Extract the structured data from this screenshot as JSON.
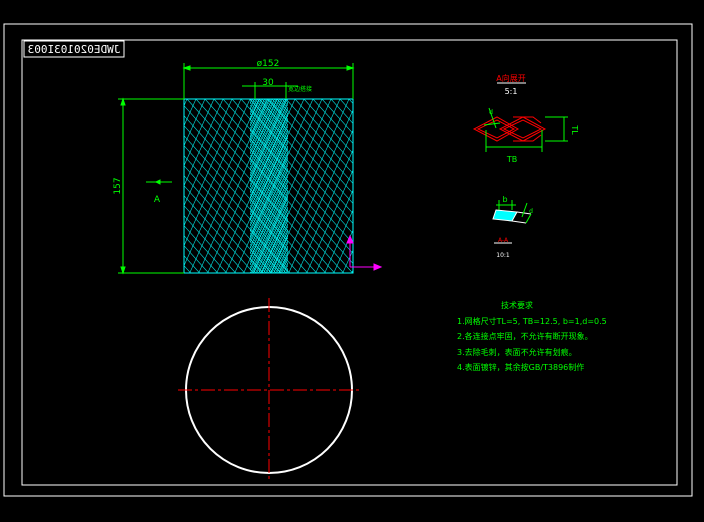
{
  "drawing": {
    "drawing_number": "JWDE020103I003",
    "dim_diameter": "ø152",
    "dim_width": "30",
    "dim_height": "157",
    "stiffener_note": "宽边搭接",
    "section_marker": "A"
  },
  "detail_view": {
    "title": "A向展开",
    "scale": "5:1",
    "dim_tb": "TB",
    "dim_tl": "TL",
    "dim_small": "d"
  },
  "section_view": {
    "dim_b": "b",
    "dim_d": "d",
    "label": "A-A",
    "scale": "10:1"
  },
  "tech_notes": {
    "title": "技术要求",
    "items": [
      "1.网格尺寸TL=5, TB=12.5, b=1,d=0.5",
      "2.各连接点牢固，不允许有断开现象。",
      "3.去除毛刺，表面不允许有划痕。",
      "4.表面镀锌，其余按GB/T3896制作"
    ]
  },
  "colors": {
    "frame": "#ffffff",
    "dimension": "#00ff00",
    "mesh": "#00ffff",
    "centerline": "#ff0000",
    "arrow": "#ff00ff",
    "notes": "#00ff00",
    "circle": "#ffffff"
  }
}
